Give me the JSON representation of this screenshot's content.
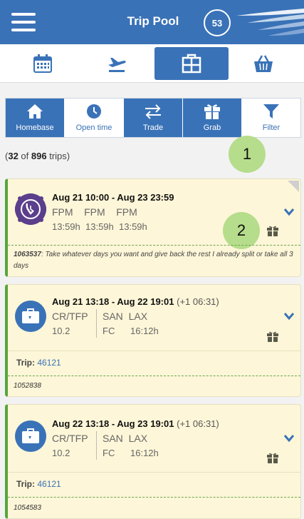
{
  "header": {
    "title": "Trip Pool",
    "badge": "53"
  },
  "topnav": {
    "items": [
      "calendar-icon",
      "plane-icon",
      "trip-pool-icon",
      "basket-icon"
    ],
    "active": 2
  },
  "actions": [
    {
      "label": "Homebase",
      "icon": "home-icon"
    },
    {
      "label": "Open time",
      "icon": "clock-icon"
    },
    {
      "label": "Trade",
      "icon": "swap-icon"
    },
    {
      "label": "Grab",
      "icon": "gift-icon"
    },
    {
      "label": "Filter",
      "icon": "filter-icon"
    }
  ],
  "summary": {
    "shown": "32",
    "total": "896",
    "open": "(",
    "of": " of ",
    "close": " trips)"
  },
  "bubbles": [
    "1",
    "2"
  ],
  "cards": [
    {
      "dates": "Aug 21 10:00 - Aug 23 23:59",
      "duration": "",
      "codes": [
        "FPM",
        "FPM",
        "FPM"
      ],
      "times": [
        "13:59h",
        "13:59h",
        "13:59h"
      ],
      "note_id": "1063537",
      "note": ": Take whatever days you want and give back the rest I already split or take all 3 days"
    },
    {
      "dates": "Aug 21 13:18 - Aug 22 19:01",
      "duration": "(+1 06:31)",
      "code": "CR/TFP",
      "value": "10.2",
      "route": "SAN  LAX",
      "cls": "FC",
      "block": "16:12h",
      "trip_label": "Trip:",
      "trip_no": "46121",
      "id": "1052838"
    },
    {
      "dates": "Aug 22 13:18 - Aug 23 19:01",
      "duration": "(+1 06:31)",
      "code": "CR/TFP",
      "value": "10.2",
      "route": "SAN  LAX",
      "cls": "FC",
      "block": "16:12h",
      "trip_label": "Trip:",
      "trip_no": "46121",
      "id": "1054583"
    }
  ],
  "colors": {
    "brand": "#3a72b7",
    "card_bg": "#fdf6d8",
    "accent_green": "#57a53b",
    "bubble": "#b6dd8b"
  }
}
